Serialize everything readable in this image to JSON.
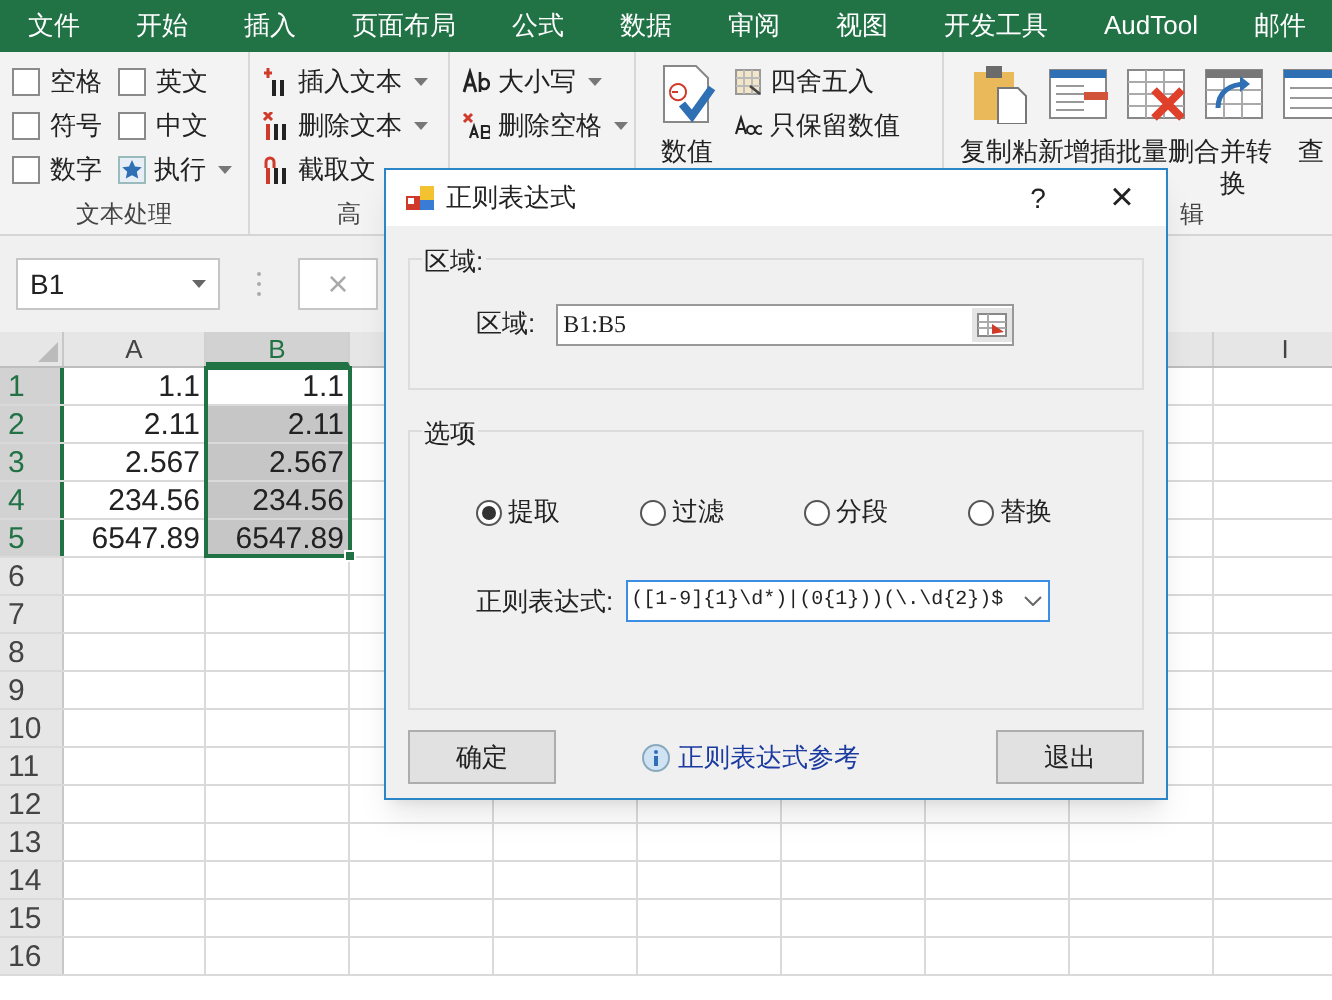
{
  "ribbon_tabs": [
    {
      "label": "文件"
    },
    {
      "label": "开始"
    },
    {
      "label": "插入"
    },
    {
      "label": "页面布局"
    },
    {
      "label": "公式"
    },
    {
      "label": "数据"
    },
    {
      "label": "审阅"
    },
    {
      "label": "视图"
    },
    {
      "label": "开发工具"
    },
    {
      "label": "AudTool"
    },
    {
      "label": "邮件"
    }
  ],
  "ribbon_groups": [
    {
      "label": "文本处理",
      "items": [
        {
          "kind": "checkbox",
          "label": "空格",
          "checked": false
        },
        {
          "kind": "checkbox",
          "label": "符号",
          "checked": false
        },
        {
          "kind": "checkbox",
          "label": "数字",
          "checked": false
        },
        {
          "kind": "checkbox",
          "label": "英文",
          "checked": false
        },
        {
          "kind": "checkbox",
          "label": "中文",
          "checked": false
        },
        {
          "kind": "menu",
          "label": "执行"
        }
      ]
    },
    {
      "label": "高",
      "items": [
        {
          "kind": "menu",
          "label": "插入文本"
        },
        {
          "kind": "menu",
          "label": "删除文本"
        },
        {
          "kind": "plain",
          "label": "截取文"
        }
      ]
    },
    {
      "items": [
        {
          "kind": "menu",
          "label": "大小写"
        },
        {
          "kind": "menu",
          "label": "删除空格"
        }
      ]
    },
    {
      "items": [
        {
          "kind": "large",
          "label": "数值"
        },
        {
          "kind": "plain",
          "label": "四舍五入"
        },
        {
          "kind": "plain",
          "label": "只保留数值"
        }
      ]
    },
    {
      "label": "辑",
      "items": [
        {
          "kind": "large",
          "label": "复制粘"
        },
        {
          "kind": "large",
          "label": "新增插"
        },
        {
          "kind": "large",
          "label": "批量删"
        },
        {
          "kind": "large",
          "label": "合并转",
          "second_line": "换"
        },
        {
          "kind": "large",
          "label": "查"
        }
      ]
    }
  ],
  "formula_bar": {
    "name_box": "B1",
    "cancel_glyph": "×"
  },
  "sheet": {
    "columns": [
      {
        "label": "A",
        "selected": false
      },
      {
        "label": "B",
        "selected": true
      },
      {
        "label": "I",
        "selected": false
      }
    ],
    "rows": [
      {
        "header": "1",
        "selected": true,
        "cells": [
          "1.1",
          "1.1"
        ]
      },
      {
        "header": "2",
        "selected": true,
        "cells": [
          "2.11",
          "2.11"
        ]
      },
      {
        "header": "3",
        "selected": true,
        "cells": [
          "2.567",
          "2.567"
        ]
      },
      {
        "header": "4",
        "selected": true,
        "cells": [
          "234.56",
          "234.56"
        ]
      },
      {
        "header": "5",
        "selected": true,
        "cells": [
          "6547.89",
          "6547.89"
        ]
      },
      {
        "header": "6",
        "selected": false,
        "cells": []
      },
      {
        "header": "7",
        "selected": false,
        "cells": []
      },
      {
        "header": "8",
        "selected": false,
        "cells": []
      },
      {
        "header": "9",
        "selected": false,
        "cells": []
      },
      {
        "header": "10",
        "selected": false,
        "cells": []
      },
      {
        "header": "11",
        "selected": false,
        "cells": []
      },
      {
        "header": "12",
        "selected": false,
        "cells": []
      },
      {
        "header": "13",
        "selected": false,
        "cells": []
      },
      {
        "header": "14",
        "selected": false,
        "cells": []
      },
      {
        "header": "15",
        "selected": false,
        "cells": []
      },
      {
        "header": "16",
        "selected": false,
        "cells": []
      }
    ]
  },
  "dialog": {
    "title": "正则表达式",
    "help": "?",
    "close": "×",
    "range_group": {
      "title": "区域:",
      "label": "区域:",
      "value": "B1:B5"
    },
    "options_group": {
      "title": "选项",
      "modes": [
        {
          "label": "提取",
          "selected": true
        },
        {
          "label": "过滤",
          "selected": false
        },
        {
          "label": "分段",
          "selected": false
        },
        {
          "label": "替换",
          "selected": false
        }
      ],
      "pattern_label": "正则表达式:",
      "pattern_value": "([1-9]{1}\\d*)|(0{1}))(\\.\\d{2})$"
    },
    "ok_button": "确定",
    "reference_link": "正则表达式参考",
    "exit_button": "退出"
  }
}
